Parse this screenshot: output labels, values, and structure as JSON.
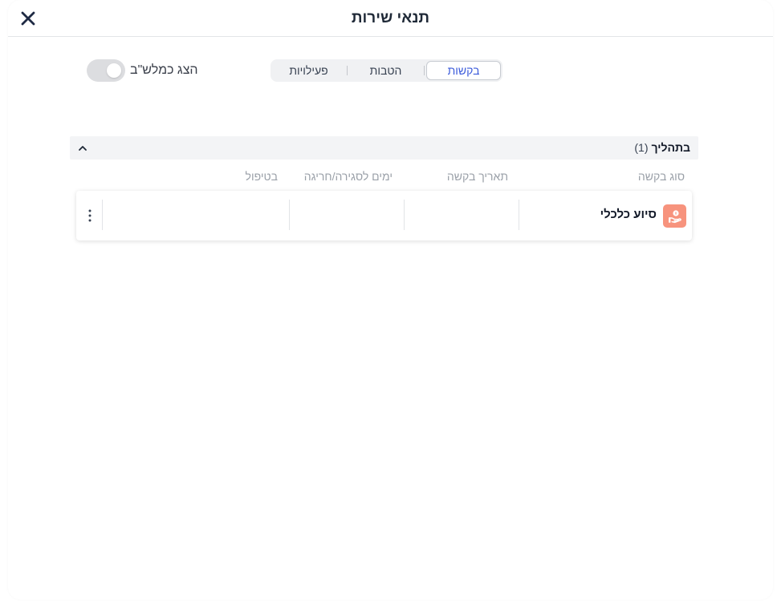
{
  "header": {
    "title": "תנאי שירות",
    "close_icon": "close-icon"
  },
  "toggle": {
    "label": "הצג כמלש\"ב",
    "checked": false
  },
  "tabs": [
    {
      "label": "בקשות",
      "active": true
    },
    {
      "label": "הטבות",
      "active": false
    },
    {
      "label": "פעילויות",
      "active": false
    }
  ],
  "section": {
    "title": "בתהליך",
    "count": "(1)",
    "collapse_icon": "chevron-up-icon"
  },
  "columns": {
    "type": "סוג בקשה",
    "date": "תאריך בקשה",
    "days": "ימים לסגירה/חריגה",
    "handling": "בטיפול"
  },
  "rows": [
    {
      "name": "סיוע כלכלי",
      "icon": "hand-money-icon",
      "icon_color": "#f7937d",
      "date": "",
      "days": "",
      "handling": "",
      "menu_icon": "kebab-menu-icon"
    }
  ],
  "colors": {
    "accent": "#3b5bdb",
    "icon_bg": "#f7937d"
  }
}
